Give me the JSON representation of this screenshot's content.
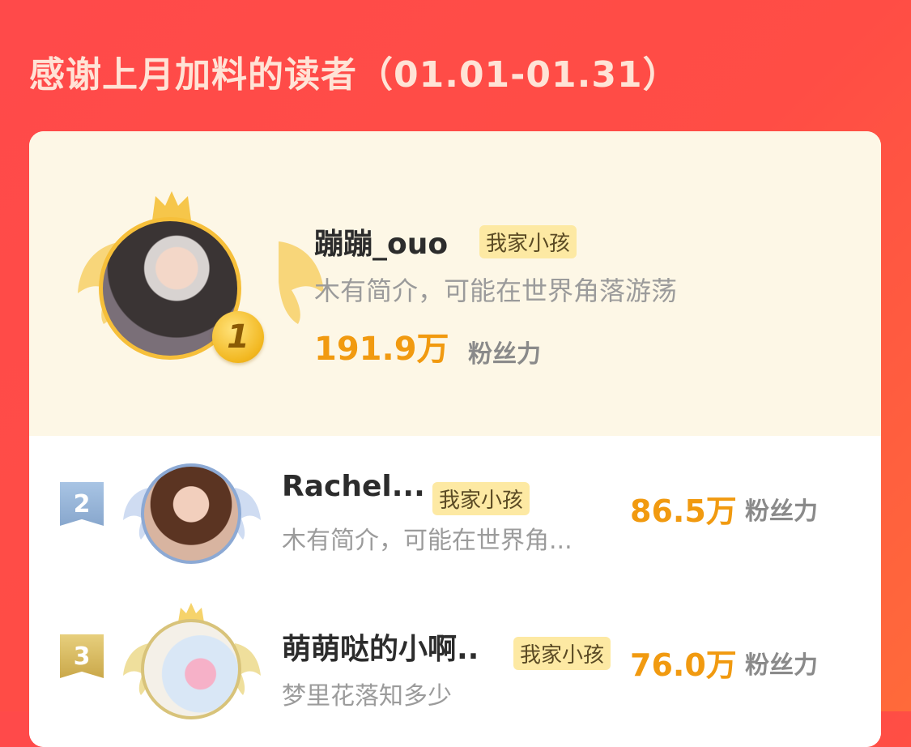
{
  "header": {
    "title": "感谢上月加料的读者（01.01-01.31）"
  },
  "ranking": [
    {
      "rank": "1",
      "name": "蹦蹦_ouo",
      "tag": "我家小孩",
      "bio": "木有简介，可能在世界角落游荡",
      "score": "191.9万",
      "unit": "粉丝力"
    },
    {
      "rank": "2",
      "name": "Rachel...",
      "tag": "我家小孩",
      "bio": "木有简介，可能在世界角...",
      "score": "86.5万",
      "unit": "粉丝力"
    },
    {
      "rank": "3",
      "name": "萌萌哒的小啊..",
      "tag": "我家小孩",
      "bio": "梦里花落知多少",
      "score": "76.0万",
      "unit": "粉丝力"
    }
  ],
  "colors": {
    "background": "#ff4a4a",
    "gold": "#f19a10",
    "tag_bg": "#fde9a3",
    "silver": "#8ca9d4",
    "bronze": "#d8c37a"
  }
}
